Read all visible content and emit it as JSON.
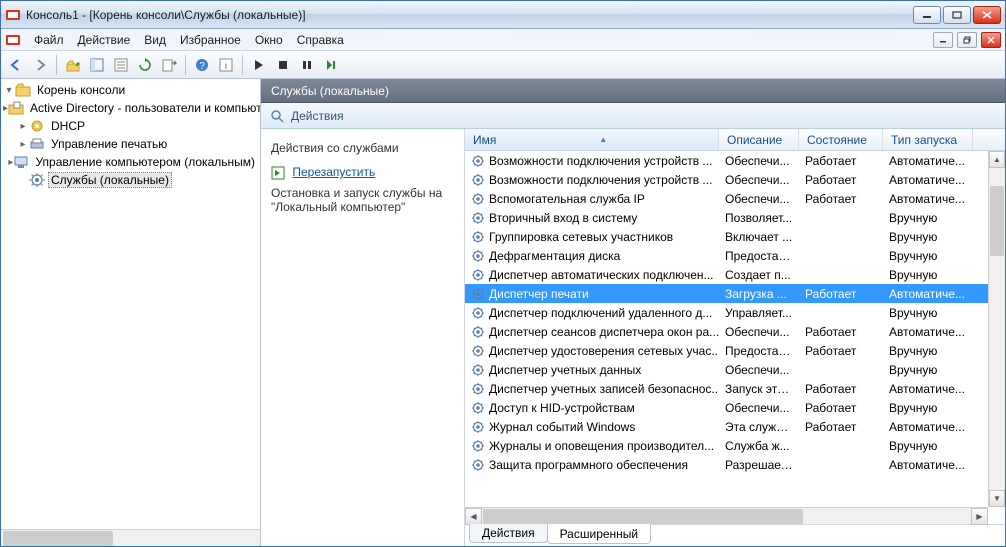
{
  "window": {
    "title": "Консоль1 - [Корень консоли\\Службы (локальные)]"
  },
  "menus": [
    "Файл",
    "Действие",
    "Вид",
    "Избранное",
    "Окно",
    "Справка"
  ],
  "tree": {
    "root": "Корень консоли",
    "items": [
      {
        "label": "Active Directory - пользователи и компьютеры",
        "expandable": true,
        "icon": "ad"
      },
      {
        "label": "DHCP",
        "expandable": true,
        "icon": "dhcp"
      },
      {
        "label": "Управление печатью",
        "expandable": true,
        "icon": "print"
      },
      {
        "label": "Управление компьютером (локальным)",
        "expandable": true,
        "icon": "compmgmt"
      },
      {
        "label": "Службы (локальные)",
        "expandable": false,
        "icon": "services",
        "selected": true
      }
    ]
  },
  "header": {
    "title": "Службы (локальные)",
    "actions_label": "Действия"
  },
  "desc": {
    "heading": "Действия со службами",
    "link": "Перезапустить",
    "text1": "Остановка и запуск службы на \"Локальный компьютер\""
  },
  "columns": [
    "Имя",
    "Описание",
    "Состояние",
    "Тип запуска"
  ],
  "rows": [
    {
      "name": "Возможности подключения устройств ...",
      "desc": "Обеспечи...",
      "state": "Работает",
      "start": "Автоматиче..."
    },
    {
      "name": "Возможности подключения устройств ...",
      "desc": "Обеспечи...",
      "state": "Работает",
      "start": "Автоматиче..."
    },
    {
      "name": "Вспомогательная служба IP",
      "desc": "Обеспечи...",
      "state": "Работает",
      "start": "Автоматиче..."
    },
    {
      "name": "Вторичный вход в систему",
      "desc": "Позволяет...",
      "state": "",
      "start": "Вручную"
    },
    {
      "name": "Группировка сетевых участников",
      "desc": "Включает ...",
      "state": "",
      "start": "Вручную"
    },
    {
      "name": "Дефрагментация диска",
      "desc": "Предостав...",
      "state": "",
      "start": "Вручную"
    },
    {
      "name": "Диспетчер автоматических подключен...",
      "desc": "Создает п...",
      "state": "",
      "start": "Вручную"
    },
    {
      "name": "Диспетчер печати",
      "desc": "Загрузка ...",
      "state": "Работает",
      "start": "Автоматиче...",
      "selected": true
    },
    {
      "name": "Диспетчер подключений удаленного д...",
      "desc": "Управляет...",
      "state": "",
      "start": "Вручную"
    },
    {
      "name": "Диспетчер сеансов диспетчера окон ра...",
      "desc": "Обеспечи...",
      "state": "Работает",
      "start": "Автоматиче..."
    },
    {
      "name": "Диспетчер удостоверения сетевых учас...",
      "desc": "Предостав...",
      "state": "Работает",
      "start": "Вручную"
    },
    {
      "name": "Диспетчер учетных данных",
      "desc": "Обеспечи...",
      "state": "",
      "start": "Вручную"
    },
    {
      "name": "Диспетчер учетных записей безопаснос...",
      "desc": "Запуск это...",
      "state": "Работает",
      "start": "Автоматиче..."
    },
    {
      "name": "Доступ к HID-устройствам",
      "desc": "Обеспечи...",
      "state": "Работает",
      "start": "Вручную"
    },
    {
      "name": "Журнал событий Windows",
      "desc": "Эта служб...",
      "state": "Работает",
      "start": "Автоматиче..."
    },
    {
      "name": "Журналы и оповещения производител...",
      "desc": "Служба ж...",
      "state": "",
      "start": "Вручную"
    },
    {
      "name": "Защита программного обеспечения",
      "desc": "Разрешает...",
      "state": "",
      "start": "Автоматиче..."
    }
  ],
  "foot_tabs": [
    "Действия",
    "Расширенный"
  ],
  "foot_active": 1
}
